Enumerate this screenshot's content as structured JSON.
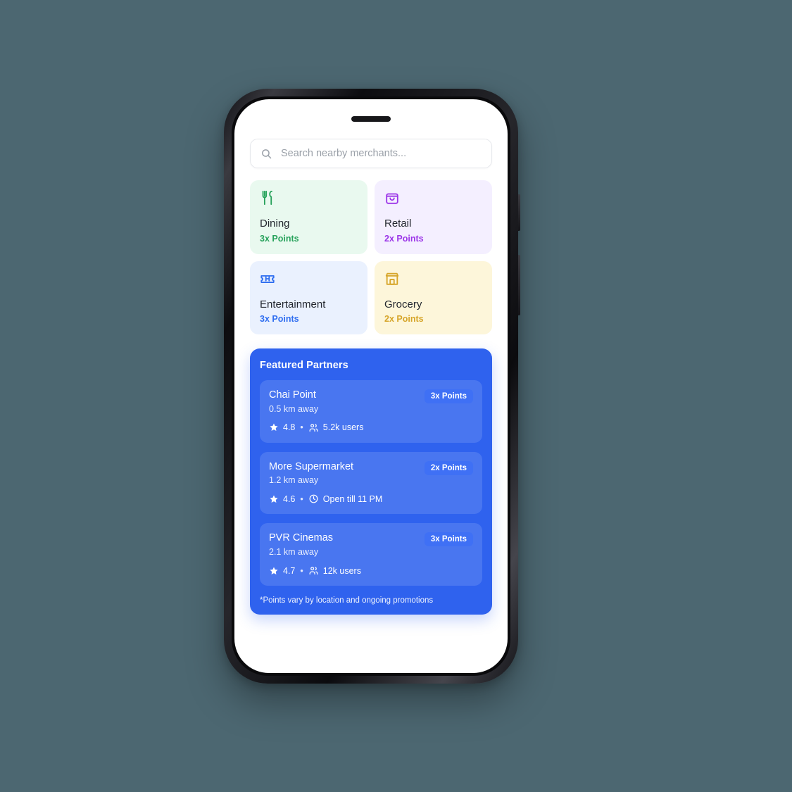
{
  "device": {
    "type": "smartphone-mockup",
    "speaker_slot": true
  },
  "background_color": "#4c6771",
  "search": {
    "placeholder": "Search nearby merchants...",
    "value": "",
    "icon": "search-icon"
  },
  "categories": [
    {
      "name": "Dining",
      "points": "3x Points",
      "icon": "utensils-icon",
      "color": "#27a25b",
      "bg": "#e9f9ef"
    },
    {
      "name": "Retail",
      "points": "2x Points",
      "icon": "shopping-bag-icon",
      "color": "#9b34e8",
      "bg": "#f4efff"
    },
    {
      "name": "Entertainment",
      "points": "3x Points",
      "icon": "ticket-icon",
      "color": "#2f6ef0",
      "bg": "#eaf1fe"
    },
    {
      "name": "Grocery",
      "points": "2x Points",
      "icon": "store-icon",
      "color": "#d6a529",
      "bg": "#fdf6da"
    }
  ],
  "featured": {
    "title": "Featured Partners",
    "panel_color": "#2f62ee",
    "badge_color": "#3f70f5",
    "footnote": "*Points vary by location and ongoing promotions",
    "partners": [
      {
        "name": "Chai Point",
        "distance": "0.5 km away",
        "badge": "3x Points",
        "rating": "4.8",
        "separator": "•",
        "detail": "5.2k users",
        "detail_icon": "users-icon"
      },
      {
        "name": "More Supermarket",
        "distance": "1.2 km away",
        "badge": "2x Points",
        "rating": "4.6",
        "separator": "•",
        "detail": "Open till 11 PM",
        "detail_icon": "clock-icon"
      },
      {
        "name": "PVR Cinemas",
        "distance": "2.1 km away",
        "badge": "3x Points",
        "rating": "4.7",
        "separator": "•",
        "detail": "12k users",
        "detail_icon": "users-icon"
      }
    ]
  }
}
